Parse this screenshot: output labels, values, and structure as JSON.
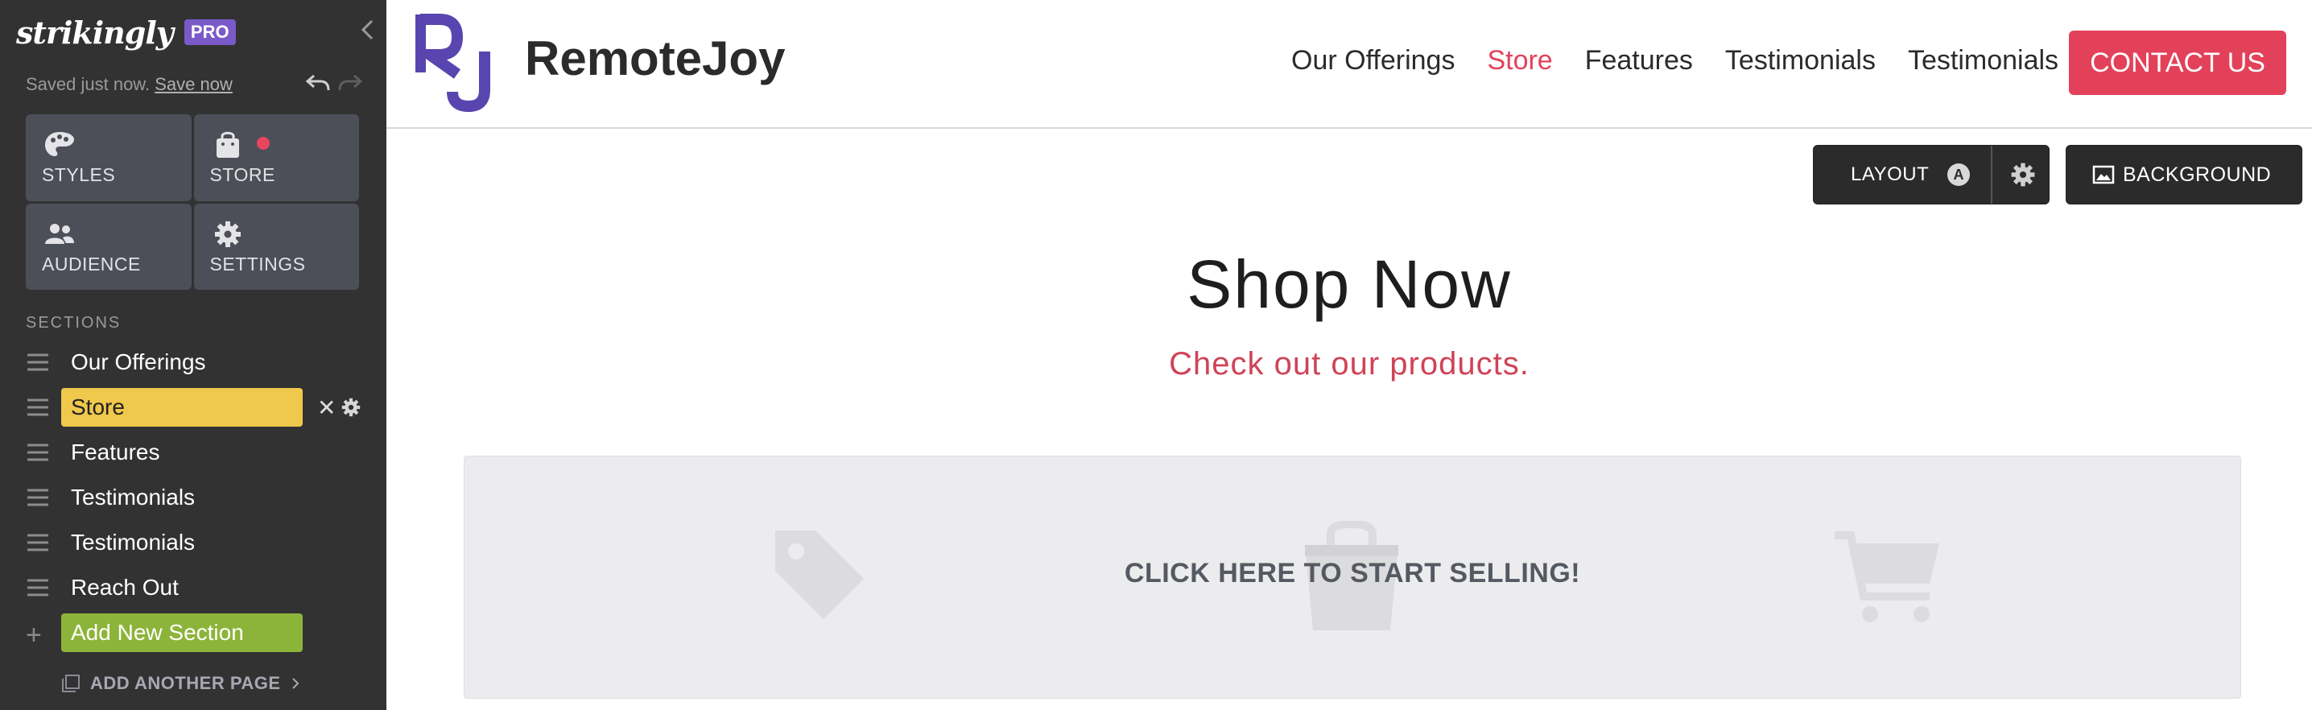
{
  "sidebar": {
    "logo": "strikingly",
    "badge": "PRO",
    "saved_text": "Saved just now.",
    "save_link": "Save now",
    "tools": [
      {
        "label": "STYLES",
        "icon": "palette-icon"
      },
      {
        "label": "STORE",
        "icon": "shopping-bag-icon",
        "notification": true
      },
      {
        "label": "AUDIENCE",
        "icon": "people-icon"
      },
      {
        "label": "SETTINGS",
        "icon": "gear-icon"
      }
    ],
    "sections_heading": "SECTIONS",
    "sections": [
      {
        "label": "Our Offerings"
      },
      {
        "label": "Store",
        "active": true
      },
      {
        "label": "Features"
      },
      {
        "label": "Testimonials"
      },
      {
        "label": "Testimonials"
      },
      {
        "label": "Reach Out"
      }
    ],
    "add_section": "Add New Section",
    "add_page": "ADD ANOTHER PAGE",
    "close_glyph": "✕",
    "colors": {
      "bg": "#323232",
      "active": "#efc84c",
      "add": "#8db43a",
      "badge": "#7a5ac8"
    }
  },
  "site": {
    "logo_letters": "RJ",
    "name": "RemoteJoy",
    "nav": [
      "Our Offerings",
      "Store",
      "Features",
      "Testimonials",
      "Testimonials"
    ],
    "current_nav": "Store",
    "contact": "CONTACT US",
    "accent": "#e3415a"
  },
  "editor": {
    "layout_label": "LAYOUT",
    "layout_variant": "A",
    "background_label": "BACKGROUND"
  },
  "content": {
    "title": "Shop Now",
    "subtitle": "Check out our products.",
    "store_cta": "CLICK HERE TO START SELLING!"
  }
}
